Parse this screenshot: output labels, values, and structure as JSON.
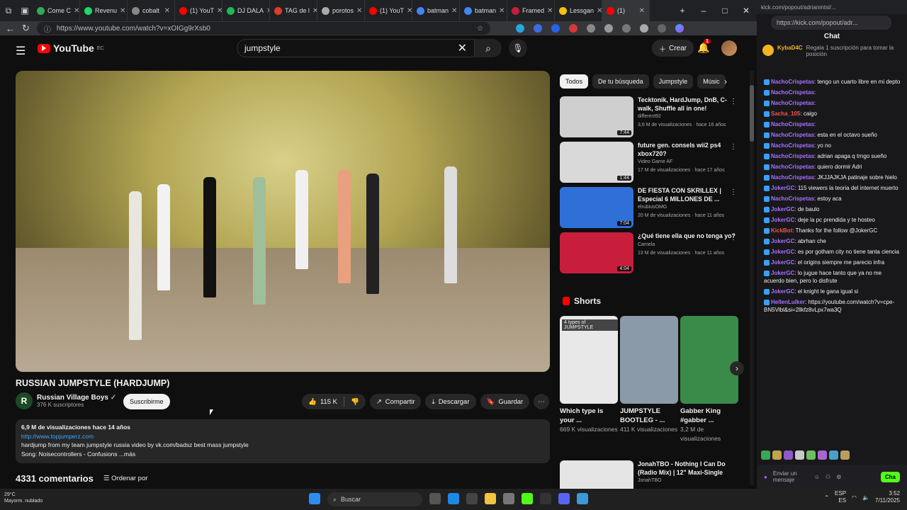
{
  "browser": {
    "tabs": [
      {
        "label": "Come C",
        "color": "#34a853"
      },
      {
        "label": "Revenu",
        "color": "#1bd96a"
      },
      {
        "label": "cobalt",
        "color": "#888888"
      },
      {
        "label": "(1) YouT",
        "color": "#ff0000"
      },
      {
        "label": "DJ DALA",
        "color": "#1db954"
      },
      {
        "label": "TAG de l",
        "color": "#e03b2b"
      },
      {
        "label": "porotos",
        "color": "#aaaaaa"
      },
      {
        "label": "(1) YouT",
        "color": "#ff0000"
      },
      {
        "label": "batman",
        "color": "#4285f4"
      },
      {
        "label": "batman",
        "color": "#4285f4"
      },
      {
        "label": "Framed",
        "color": "#c81e3c"
      },
      {
        "label": "Lessgan",
        "color": "#f4c20d"
      },
      {
        "label": "(1)",
        "color": "#ff0000"
      }
    ],
    "url": "https://www.youtube.com/watch?v=xOIGg9rXsb0"
  },
  "youtube": {
    "logo_text": "YouTube",
    "logo_suffix": "EC",
    "search_value": "jumpstyle",
    "create_label": "Crear",
    "notif_count": "1"
  },
  "video": {
    "title": "RUSSIAN JUMPSTYLE (HARDJUMP)",
    "channel": "Russian Village Boys",
    "channel_initial": "R",
    "subscribers": "376 K suscriptores",
    "subscribe_label": "Suscribirme",
    "likes": "115 K",
    "share_label": "Compartir",
    "download_label": "Descargar",
    "save_label": "Guardar",
    "desc_meta": "6,9 M de visualizaciones  hace 14 años",
    "desc_link": "http://www.topjumperz.com",
    "desc_line1": "hardjump from my team jumpstyle russia video by vk.com/badsz best mass jumpstyle",
    "desc_line2": "Song: Noisecontrollers - Confusions ...más",
    "comments_count": "4331 comentarios",
    "sort_label": "Ordenar por"
  },
  "sidebar": {
    "chips": [
      "Todos",
      "De tu búsqueda",
      "Jumpstyle",
      "Músic"
    ],
    "recommendations": [
      {
        "title": "Tecktonik, HardJump, DnB, C-walk, Shuffle all in one!",
        "channel": "different92",
        "meta": "3,6 M de visualizaciones · hace 16 años",
        "duration": "7:44",
        "color": "#cfcfcf"
      },
      {
        "title": "future gen. consels wii2 ps4 xbox720?",
        "channel": "Video Game AF",
        "meta": "17 M de visualizaciones · hace 17 años",
        "duration": "1:44",
        "color": "#d9d9d9"
      },
      {
        "title": "DE FIESTA CON SKRILLEX | Especial 6 MILLONES DE ...",
        "channel": "elrubiusOMG",
        "meta": "20 M de visualizaciones · hace 11 años",
        "duration": "7:04",
        "color": "#2f6fd8"
      },
      {
        "title": "¿Qué tiene ella que no tenga yo?",
        "channel": "Camela",
        "meta": "13 M de visualizaciones · hace 11 años",
        "duration": "4:04",
        "color": "#c81e3c"
      }
    ],
    "shorts_title": "Shorts",
    "shorts": [
      {
        "title": "Which type is your ...",
        "views": "669 K visualizaciones",
        "overlay": "4 types of JUMPSTYLE",
        "color": "#e8e8e8"
      },
      {
        "title": "JUMPSTYLE BOOTLEG - ...",
        "views": "411 K visualizaciones",
        "overlay": "",
        "color": "#8a9aa8"
      },
      {
        "title": "Gabber King #gabber ...",
        "views": "3,2 M de visualizaciones",
        "overlay": "",
        "color": "#3a8a4a"
      }
    ],
    "next_rec_title": "JonahTBO - Nothing I Can Do (Radio Mix) | 12\" Maxi-Single",
    "next_rec_channel": "JonahTBO"
  },
  "kick": {
    "window_title": "kick.com/popout/adrianmtsl/...",
    "url": "https://kick.com/popout/adr...",
    "chat_title": "Chat",
    "pinned_user": "KybaD4C",
    "pinned_text": "Regala 1 suscripción para tomar la posición",
    "messages": [
      {
        "user": "NachoCrispetas",
        "text": "tengo un cuarto libre en mi depto",
        "color": "#a970ff"
      },
      {
        "user": "NachoCrispetas",
        "text": "",
        "color": "#a970ff"
      },
      {
        "user": "NachoCrispetas",
        "text": "",
        "color": "#a970ff"
      },
      {
        "user": "Sacha_105",
        "text": "caigo",
        "color": "#ff4f4f"
      },
      {
        "user": "NachoCrispetas",
        "text": "",
        "color": "#a970ff"
      },
      {
        "user": "NachoCrispetas",
        "text": "esta en el octavo sueño",
        "color": "#a970ff"
      },
      {
        "user": "NachoCrispetas",
        "text": "yo no",
        "color": "#a970ff"
      },
      {
        "user": "NachoCrispetas",
        "text": "adrian apaga q trngo sueño",
        "color": "#a970ff"
      },
      {
        "user": "NachoCrispetas",
        "text": "quiero dormir Adri",
        "color": "#a970ff"
      },
      {
        "user": "NachoCrispetas",
        "text": "JKJJAJKJA patinaje sobre hielo",
        "color": "#a970ff"
      },
      {
        "user": "JokerGC",
        "text": "115 viewers la teoria del internet muerto",
        "color": "#a970ff"
      },
      {
        "user": "NachoCrispetas",
        "text": "estoy aca",
        "color": "#a970ff"
      },
      {
        "user": "JokerGC",
        "text": "de baulo",
        "color": "#a970ff"
      },
      {
        "user": "JokerGC",
        "text": "deje la pc prendida y te hosteo",
        "color": "#a970ff"
      },
      {
        "user": "KickBot",
        "text": "Thanks for the follow @JokerGC",
        "color": "#ff4f4f"
      },
      {
        "user": "JokerGC",
        "text": "abrhan che",
        "color": "#a970ff"
      },
      {
        "user": "JokerGC",
        "text": "es por gotham city no tiene tanta ciencia",
        "color": "#a970ff"
      },
      {
        "user": "JokerGC",
        "text": "el origins siempre me parecio infra",
        "color": "#a970ff"
      },
      {
        "user": "JokerGC",
        "text": "lo jugue hace tanto que ya no me acuerdo bien, pero lo disfrute",
        "color": "#a970ff"
      },
      {
        "user": "JokerGC",
        "text": "el knight le gana igual si",
        "color": "#a970ff"
      },
      {
        "user": "HellenLulker",
        "text": "https://youtube.com/watch?v=cpe-BN5Vlbl&si=2llkfz8vLpx7wa3Q",
        "color": "#a970ff"
      }
    ],
    "send_placeholder": "Enviar un mensaje",
    "chat_button": "Cha"
  },
  "taskbar": {
    "weather_temp": "29°C",
    "weather_desc": "Mayorm. nublado",
    "search_label": "Buscar",
    "lang": "ESP",
    "lang2": "ES",
    "time": "3:52",
    "date": "7/11/2025"
  }
}
